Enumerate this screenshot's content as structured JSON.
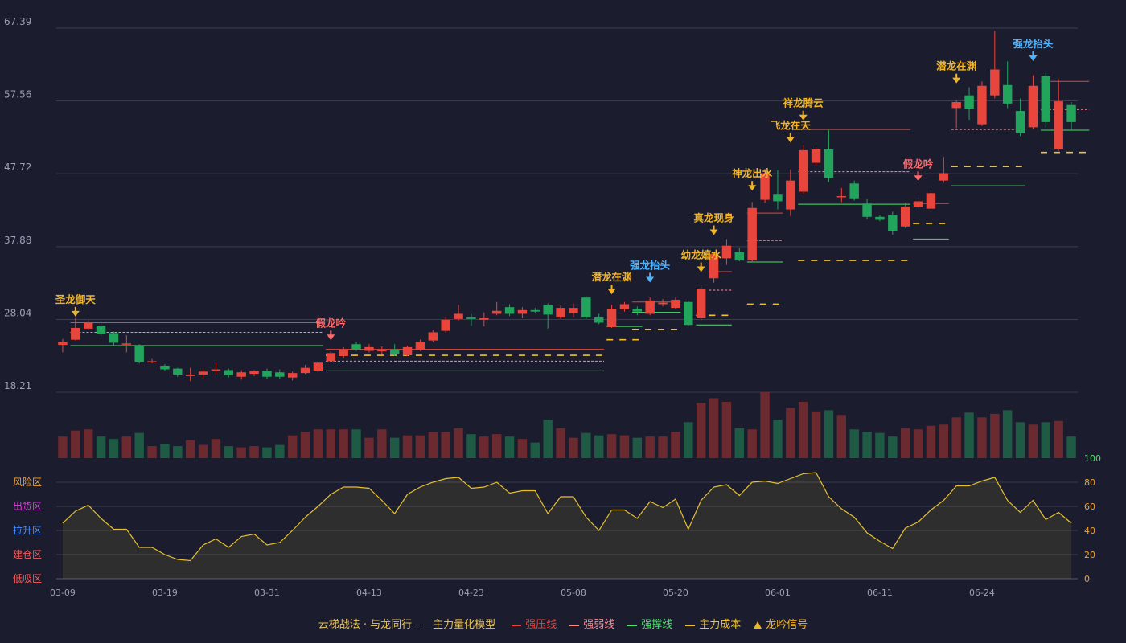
{
  "chart_data": {
    "type": "candlestick",
    "price_axis": {
      "ticks": [
        "67.39",
        "57.56",
        "47.72",
        "37.88",
        "28.04",
        "18.21"
      ],
      "min": 18.21,
      "max": 67.39
    },
    "date_labels": [
      {
        "label": "03-09",
        "index": 0
      },
      {
        "label": "03-19",
        "index": 8
      },
      {
        "label": "03-31",
        "index": 16
      },
      {
        "label": "04-13",
        "index": 24
      },
      {
        "label": "04-23",
        "index": 32
      },
      {
        "label": "05-08",
        "index": 40
      },
      {
        "label": "05-20",
        "index": 48
      },
      {
        "label": "06-01",
        "index": 56
      },
      {
        "label": "06-11",
        "index": 64
      },
      {
        "label": "06-24",
        "index": 72
      }
    ],
    "candles": [
      [
        24.6,
        25.0,
        23.6,
        25.4
      ],
      [
        25.3,
        26.9,
        25.2,
        28.2
      ],
      [
        26.8,
        27.6,
        26.7,
        28.0
      ],
      [
        27.2,
        26.1,
        25.8,
        27.6
      ],
      [
        26.2,
        24.9,
        24.6,
        26.4
      ],
      [
        24.7,
        24.8,
        23.6,
        25.9
      ],
      [
        24.6,
        22.3,
        22.1,
        24.7
      ],
      [
        22.3,
        22.4,
        22.1,
        22.7
      ],
      [
        21.8,
        21.3,
        21.1,
        22.0
      ],
      [
        21.4,
        20.6,
        20.3,
        21.5
      ],
      [
        20.4,
        20.6,
        19.7,
        21.5
      ],
      [
        20.6,
        21.0,
        20.1,
        21.4
      ],
      [
        21.1,
        21.3,
        20.6,
        22.2
      ],
      [
        21.2,
        20.5,
        20.2,
        21.4
      ],
      [
        20.3,
        20.9,
        19.9,
        21.2
      ],
      [
        20.7,
        21.1,
        20.4,
        21.2
      ],
      [
        21.1,
        20.3,
        20.0,
        21.4
      ],
      [
        20.9,
        20.3,
        20.0,
        21.3
      ],
      [
        20.2,
        20.8,
        19.8,
        21.0
      ],
      [
        20.8,
        21.5,
        20.7,
        21.9
      ],
      [
        21.1,
        22.2,
        20.9,
        22.4
      ],
      [
        22.4,
        23.5,
        22.2,
        23.7
      ],
      [
        23.1,
        24.0,
        22.8,
        24.3
      ],
      [
        24.7,
        24.0,
        23.8,
        25.0
      ],
      [
        23.8,
        24.3,
        23.6,
        24.7
      ],
      [
        23.8,
        23.9,
        23.3,
        24.4
      ],
      [
        24.0,
        23.4,
        23.1,
        24.7
      ],
      [
        23.2,
        24.3,
        23.1,
        24.5
      ],
      [
        24.0,
        25.0,
        23.8,
        25.3
      ],
      [
        25.2,
        26.3,
        25.0,
        26.6
      ],
      [
        26.5,
        28.0,
        26.3,
        28.4
      ],
      [
        28.1,
        28.8,
        27.9,
        30.0
      ],
      [
        28.3,
        28.1,
        27.2,
        28.8
      ],
      [
        28.0,
        28.2,
        27.1,
        29.0
      ],
      [
        28.8,
        29.2,
        28.6,
        30.4
      ],
      [
        29.7,
        28.8,
        28.5,
        30.1
      ],
      [
        28.8,
        29.3,
        28.2,
        29.7
      ],
      [
        29.3,
        29.1,
        28.9,
        29.6
      ],
      [
        30.0,
        28.7,
        26.8,
        30.2
      ],
      [
        28.3,
        29.6,
        28.1,
        30.0
      ],
      [
        28.9,
        29.6,
        28.3,
        30.2
      ],
      [
        31.0,
        28.3,
        28.1,
        31.2
      ],
      [
        28.3,
        27.6,
        27.4,
        28.8
      ],
      [
        27.0,
        29.5,
        26.9,
        30.0
      ],
      [
        29.4,
        30.1,
        29.1,
        30.4
      ],
      [
        29.5,
        29.1,
        28.6,
        29.8
      ],
      [
        28.8,
        30.6,
        28.6,
        31.0
      ],
      [
        30.1,
        30.3,
        29.8,
        30.8
      ],
      [
        29.6,
        30.7,
        29.5,
        31.0
      ],
      [
        30.4,
        27.3,
        27.1,
        30.6
      ],
      [
        28.2,
        32.2,
        27.8,
        32.7
      ],
      [
        33.6,
        36.9,
        33.0,
        37.2
      ],
      [
        36.3,
        38.0,
        35.4,
        38.9
      ],
      [
        37.1,
        36.0,
        35.9,
        37.7
      ],
      [
        36.0,
        43.1,
        35.8,
        43.9
      ],
      [
        44.2,
        47.8,
        43.8,
        48.4
      ],
      [
        45.0,
        44.0,
        42.9,
        48.2
      ],
      [
        42.9,
        46.8,
        42.0,
        48.3
      ],
      [
        45.3,
        50.9,
        45.0,
        51.6
      ],
      [
        49.2,
        51.0,
        48.8,
        51.3
      ],
      [
        51.0,
        47.2,
        46.6,
        53.6
      ],
      [
        44.6,
        44.7,
        43.9,
        45.8
      ],
      [
        46.4,
        44.4,
        44.1,
        46.8
      ],
      [
        43.7,
        41.9,
        41.6,
        44.3
      ],
      [
        41.9,
        41.5,
        41.3,
        42.1
      ],
      [
        42.2,
        40.0,
        39.5,
        42.6
      ],
      [
        40.6,
        43.3,
        40.4,
        43.8
      ],
      [
        43.2,
        44.0,
        42.8,
        44.5
      ],
      [
        43.0,
        45.1,
        42.6,
        45.5
      ],
      [
        46.8,
        47.8,
        46.5,
        50.0
      ],
      [
        56.6,
        57.4,
        53.9,
        57.6
      ],
      [
        58.3,
        56.5,
        55.0,
        59.4
      ],
      [
        54.4,
        59.6,
        54.2,
        60.2
      ],
      [
        58.3,
        61.8,
        57.9,
        67.0
      ],
      [
        59.7,
        57.2,
        56.6,
        62.9
      ],
      [
        56.2,
        53.2,
        52.8,
        57.9
      ],
      [
        54.0,
        59.6,
        53.8,
        61.0
      ],
      [
        60.9,
        54.7,
        54.0,
        61.3
      ],
      [
        51.0,
        57.5,
        50.8,
        60.5
      ],
      [
        57.0,
        54.7,
        53.5,
        57.4
      ]
    ],
    "volume": [
      18,
      23,
      24,
      18,
      16,
      18,
      21,
      10,
      12,
      10,
      15,
      11,
      16,
      10,
      9,
      10,
      9,
      11,
      19,
      22,
      24,
      24,
      24,
      24,
      17,
      24,
      17,
      19,
      19,
      22,
      22,
      25,
      20,
      18,
      20,
      18,
      16,
      13,
      32,
      25,
      17,
      21,
      19,
      20,
      19,
      17,
      18,
      18,
      22,
      30,
      46,
      50,
      47,
      25,
      24,
      55,
      32,
      42,
      47,
      39,
      40,
      36,
      24,
      22,
      21,
      18,
      25,
      24,
      27,
      28,
      34,
      38,
      34,
      37,
      40,
      30,
      28,
      30,
      31,
      18
    ],
    "indicator": {
      "name": "主力量化模型",
      "axis_ticks": [
        "100",
        "80",
        "60",
        "40",
        "20",
        "0"
      ],
      "zones": [
        "风险区",
        "出货区",
        "拉升区",
        "建仓区",
        "低吸区"
      ],
      "values": [
        46,
        56,
        61,
        50,
        41,
        41,
        26,
        26,
        20,
        16,
        15,
        28,
        33,
        26,
        35,
        37,
        28,
        30,
        40,
        51,
        60,
        70,
        76,
        76,
        75,
        65,
        54,
        70,
        76,
        80,
        83,
        84,
        75,
        76,
        80,
        71,
        73,
        73,
        54,
        68,
        68,
        51,
        40,
        57,
        57,
        50,
        64,
        59,
        66,
        41,
        65,
        76,
        78,
        69,
        80,
        81,
        79,
        83,
        87,
        88,
        68,
        58,
        51,
        38,
        31,
        25,
        42,
        47,
        57,
        65,
        77,
        77,
        81,
        84,
        65,
        55,
        65,
        49,
        55,
        46
      ]
    },
    "levels": [
      {
        "kind": "strong-pressure",
        "from": 1,
        "to": 20,
        "value": 27.6
      },
      {
        "kind": "weak",
        "from": 1,
        "to": 20,
        "value": 26.3
      },
      {
        "kind": "support",
        "from": 1,
        "to": 20,
        "value": 24.5
      },
      {
        "kind": "strong-pressure",
        "from": 21,
        "to": 42,
        "value": 24.0
      },
      {
        "kind": "cost",
        "from": 21,
        "to": 42,
        "value": 23.2
      },
      {
        "kind": "weak",
        "from": 21,
        "to": 42,
        "value": 22.4
      },
      {
        "kind": "support",
        "from": 21,
        "to": 42,
        "value": 21.1
      },
      {
        "kind": "support",
        "from": 43,
        "to": 45,
        "value": 27.1
      },
      {
        "kind": "cost",
        "from": 43,
        "to": 45,
        "value": 25.3
      },
      {
        "kind": "strong-pressure",
        "from": 45,
        "to": 48,
        "value": 30.4
      },
      {
        "kind": "support",
        "from": 45,
        "to": 48,
        "value": 29.0
      },
      {
        "kind": "cost",
        "from": 45,
        "to": 48,
        "value": 26.7
      },
      {
        "kind": "cost",
        "from": 50,
        "to": 52,
        "value": 28.6
      },
      {
        "kind": "support",
        "from": 50,
        "to": 52,
        "value": 27.3
      },
      {
        "kind": "weak",
        "from": 51,
        "to": 52,
        "value": 32.0
      },
      {
        "kind": "strong-pressure",
        "from": 51,
        "to": 52,
        "value": 34.5
      },
      {
        "kind": "strong-pressure",
        "from": 54,
        "to": 56,
        "value": 42.4
      },
      {
        "kind": "weak",
        "from": 54,
        "to": 56,
        "value": 38.7
      },
      {
        "kind": "support",
        "from": 54,
        "to": 56,
        "value": 35.8
      },
      {
        "kind": "cost",
        "from": 54,
        "to": 56,
        "value": 30.1
      },
      {
        "kind": "strong-pressure",
        "from": 58,
        "to": 66,
        "value": 53.7
      },
      {
        "kind": "weak",
        "from": 58,
        "to": 66,
        "value": 48.0
      },
      {
        "kind": "support",
        "from": 58,
        "to": 66,
        "value": 43.6
      },
      {
        "kind": "cost",
        "from": 58,
        "to": 66,
        "value": 36.0
      },
      {
        "kind": "strong-pressure",
        "from": 67,
        "to": 69,
        "value": 43.7
      },
      {
        "kind": "cost",
        "from": 67,
        "to": 69,
        "value": 41.0
      },
      {
        "kind": "support",
        "from": 67,
        "to": 69,
        "value": 38.9
      },
      {
        "kind": "weak",
        "from": 70,
        "to": 75,
        "value": 53.7
      },
      {
        "kind": "cost",
        "from": 70,
        "to": 75,
        "value": 48.7
      },
      {
        "kind": "support",
        "from": 70,
        "to": 75,
        "value": 46.1
      },
      {
        "kind": "strong-pressure",
        "from": 77,
        "to": 80,
        "value": 60.2
      },
      {
        "kind": "weak",
        "from": 77,
        "to": 80,
        "value": 56.4
      },
      {
        "kind": "support",
        "from": 77,
        "to": 80,
        "value": 53.6
      },
      {
        "kind": "cost",
        "from": 77,
        "to": 80,
        "value": 50.6
      }
    ],
    "signals": [
      {
        "index": 1,
        "text": "圣龙御天",
        "kind": "gold",
        "high": 28.0
      },
      {
        "index": 21,
        "text": "假龙吟",
        "kind": "red",
        "high": 24.8
      },
      {
        "index": 43,
        "text": "潜龙在渊",
        "kind": "gold",
        "high": 31.0
      },
      {
        "index": 46,
        "text": "强龙抬头",
        "kind": "blue",
        "high": 32.6
      },
      {
        "index": 50,
        "text": "幼龙嬉水",
        "kind": "gold",
        "high": 34.0
      },
      {
        "index": 51,
        "text": "真龙现身",
        "kind": "gold",
        "high": 39.0
      },
      {
        "index": 54,
        "text": "神龙出水",
        "kind": "gold",
        "high": 45.0
      },
      {
        "index": 57,
        "text": "飞龙在天",
        "kind": "gold",
        "high": 51.5
      },
      {
        "index": 58,
        "text": "祥龙腾云",
        "kind": "gold",
        "high": 54.5
      },
      {
        "index": 67,
        "text": "假龙吟",
        "kind": "red",
        "high": 46.3
      },
      {
        "index": 70,
        "text": "潜龙在渊",
        "kind": "gold",
        "high": 59.5
      },
      {
        "index": 76,
        "text": "强龙抬头",
        "kind": "blue",
        "high": 62.5
      }
    ],
    "colors": {
      "up": "#e8453c",
      "down": "#22a45d",
      "vol_up": "#6b2a30",
      "vol_down": "#1e5a44",
      "pressure": "#e8453c",
      "weak": "#ff8a8a",
      "support": "#4ee06a",
      "cost": "#f0c02e",
      "signal_gold": "#f0b429",
      "signal_red": "#ff6b6b",
      "signal_blue": "#4db3ff",
      "indicator_line": "#e6c02e"
    }
  },
  "legend": {
    "title": "云梯战法 · 与龙同行——主力量化模型",
    "items": [
      {
        "label": "强压线",
        "color": "#e8453c",
        "style": "solid"
      },
      {
        "label": "强弱线",
        "color": "#ff8a8a",
        "style": "dashed"
      },
      {
        "label": "强撑线",
        "color": "#4ee06a",
        "style": "solid"
      },
      {
        "label": "主力成本",
        "color": "#f0c02e",
        "style": "dashed"
      },
      {
        "label": "龙吟信号",
        "color": "#f0b429",
        "style": "triangle"
      }
    ]
  }
}
